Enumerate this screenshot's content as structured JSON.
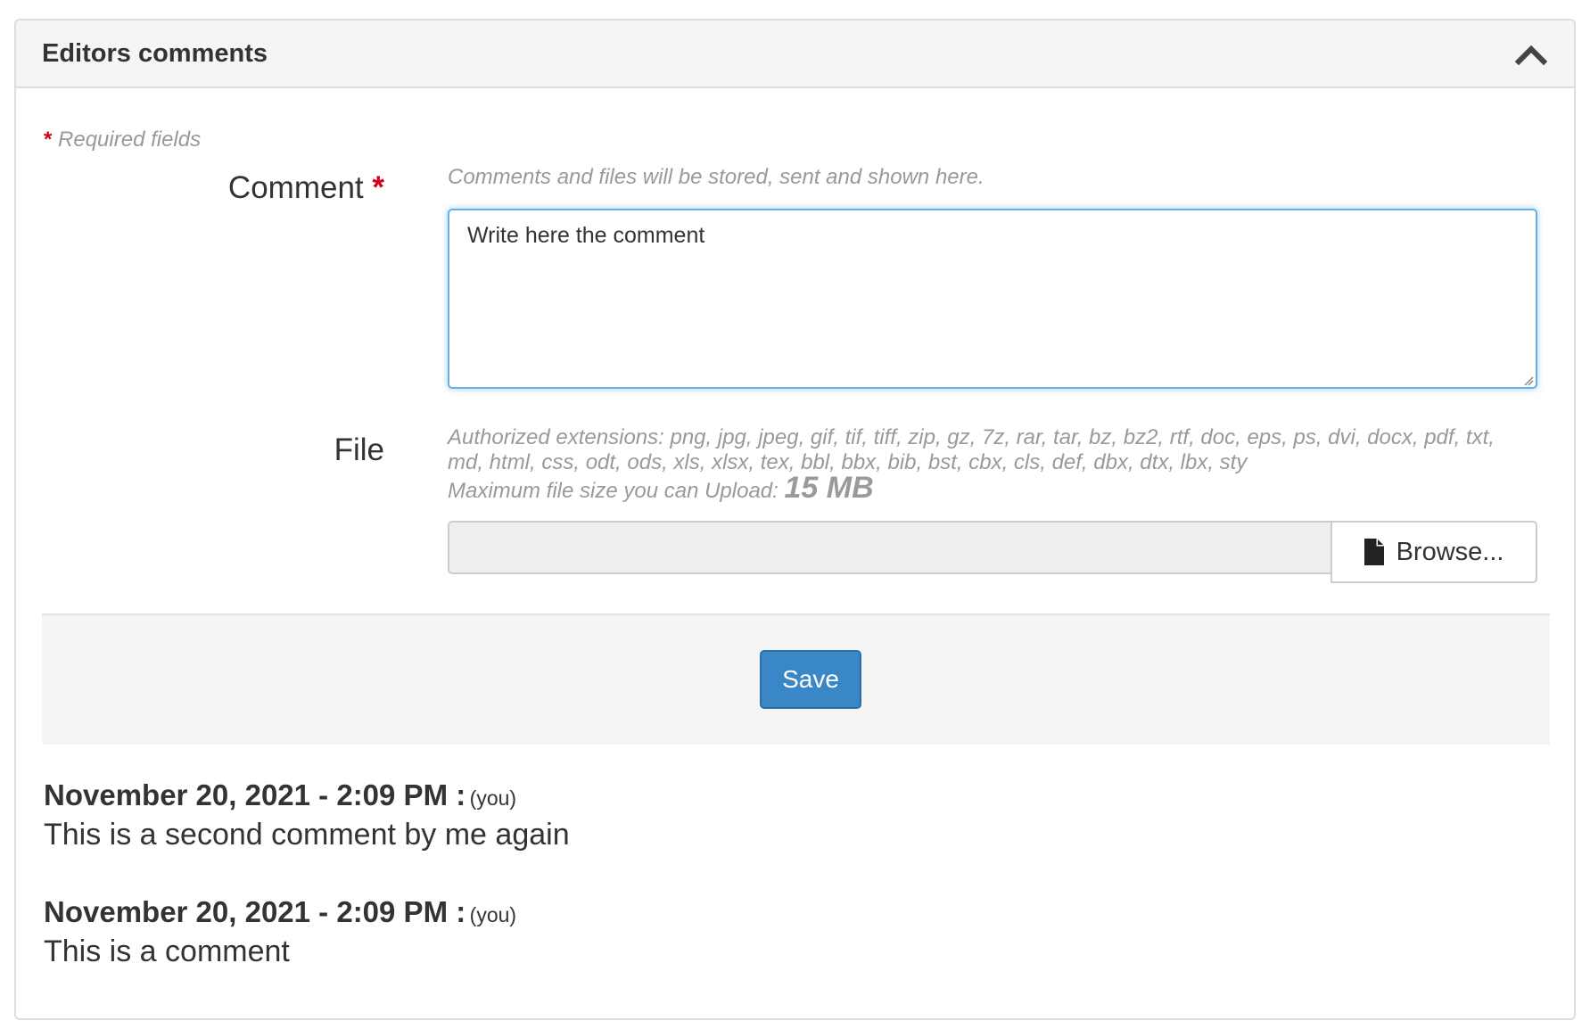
{
  "panel": {
    "title": "Editors comments"
  },
  "form": {
    "required_note": "Required fields",
    "required_star": "*",
    "comment": {
      "label": "Comment",
      "help": "Comments and files will be stored, sent and shown here.",
      "value": "Write here the comment"
    },
    "file": {
      "label": "File",
      "extensions_text": "Authorized extensions: png, jpg, jpeg, gif, tif, tiff, zip, gz, 7z, rar, tar, bz, bz2, rtf, doc, eps, ps, dvi, docx, pdf, txt, md, html, css, odt, ods, xls, xlsx, tex, bbl, bbx, bib, bst, cbx, cls, def, dbx, dtx, lbx, sty",
      "max_size_label": "Maximum file size you can Upload:",
      "max_size_value": "15 MB",
      "browse_label": "Browse...",
      "browse_icon": "file-icon"
    },
    "save_label": "Save"
  },
  "comments": [
    {
      "date": "November 20, 2021 - 2:09 PM :",
      "author": "(you)",
      "text": "This is a second comment by me again"
    },
    {
      "date": "November 20, 2021 - 2:09 PM :",
      "author": "(you)",
      "text": "This is a comment"
    }
  ],
  "colors": {
    "accent": "#3a87c8",
    "focus": "#66afe9",
    "required": "#d0021b"
  }
}
